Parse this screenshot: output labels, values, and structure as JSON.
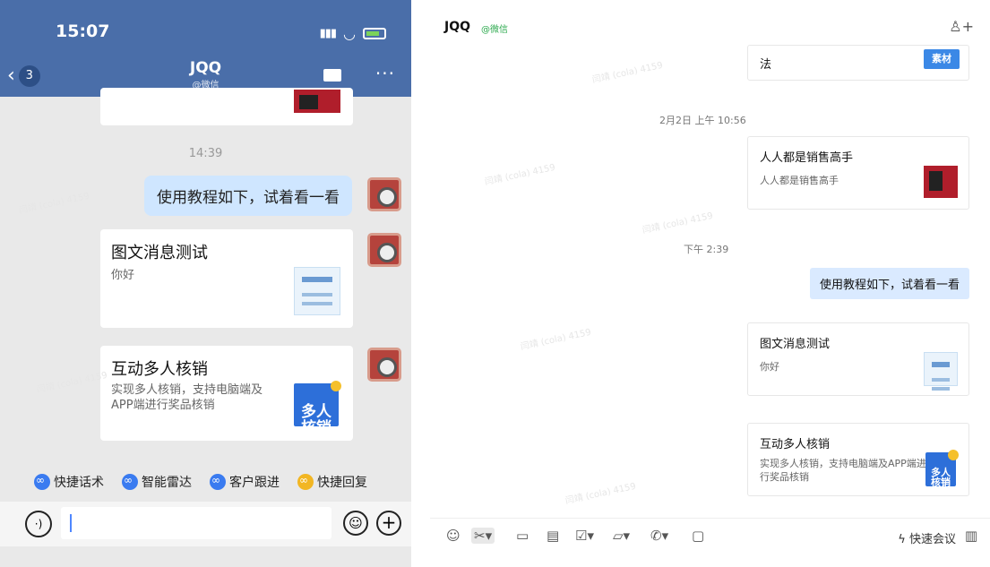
{
  "phone": {
    "status_time": "15:07",
    "back_count": "3",
    "contact_name": "JQQ",
    "contact_tag": "@微信",
    "timestamp": "14:39",
    "bubble_text": "使用教程如下，试着看一看",
    "card1": {
      "title": "图文消息测试",
      "desc": "你好"
    },
    "card2": {
      "title": "互动多人核销",
      "desc": "实现多人核销，支持电脑端及APP端进行奖品核销",
      "thumb_text": "多人\n核销"
    },
    "quick_actions": [
      "快捷话术",
      "智能雷达",
      "客户跟进",
      "快捷回复"
    ]
  },
  "desktop": {
    "contact_name": "JQQ",
    "contact_tag": "@微信",
    "top_card_fragment": "法",
    "top_card_thumb_text": "素材",
    "ts1": "2月2日 上午 10:56",
    "card_sales": {
      "title": "人人都是销售高手",
      "desc": "人人都是销售高手"
    },
    "ts2": "下午 2:39",
    "bubble_text": "使用教程如下，试着看一看",
    "card1": {
      "title": "图文消息测试",
      "desc": "你好"
    },
    "card2": {
      "title": "互动多人核销",
      "desc": "实现多人核销，支持电脑端及APP端进行奖品核销",
      "thumb_text": "多人\n核销"
    },
    "quick_meeting": "快速会议"
  },
  "watermark": "闫靖 (cola) 4159",
  "colors": {
    "phone_header": "#4a6ea9",
    "bubble_phone": "#cfe6ff",
    "bubble_desk": "#daeaff",
    "quick_icon": "#3a7bf0"
  }
}
